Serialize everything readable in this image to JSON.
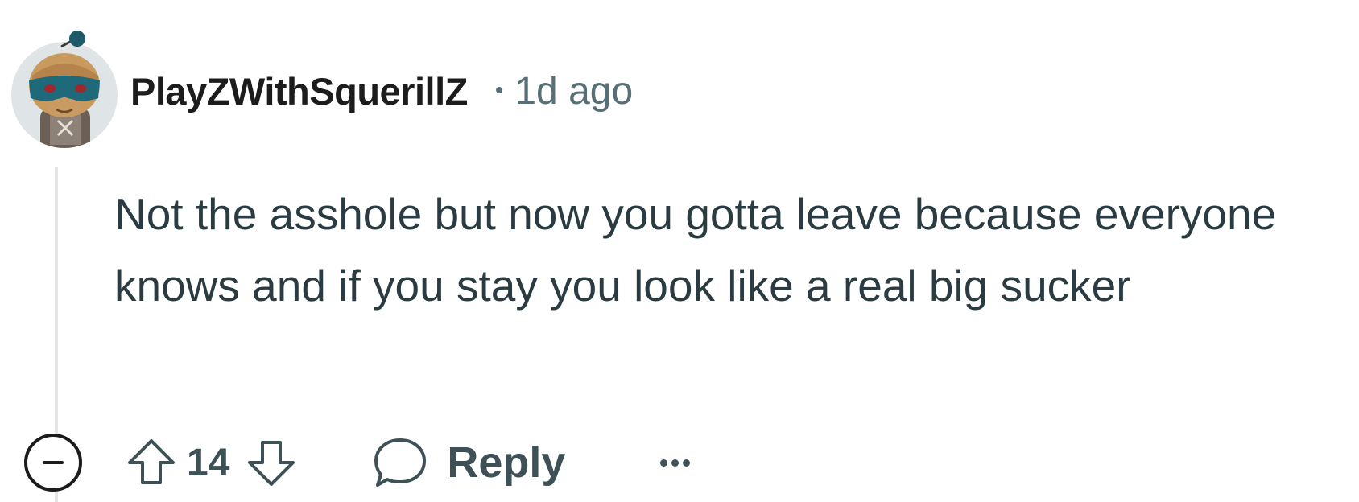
{
  "comment": {
    "username": "PlayZWithSquerillZ",
    "separator": "•",
    "timestamp": "1d ago",
    "body": "Not the asshole but now you gotta leave because everyone knows and if you stay you look like a real big sucker",
    "score": "14",
    "reply_label": "Reply"
  },
  "icons": {
    "avatar": "snoo-avatar-icon",
    "collapse": "minus-circle-icon",
    "upvote": "arrow-up-icon",
    "downvote": "arrow-down-icon",
    "reply": "speech-bubble-icon",
    "more": "ellipsis-icon"
  },
  "colors": {
    "text_primary": "#1c1c1c",
    "text_meta": "#576f76",
    "action_text": "#3d5157",
    "thread_line": "#e5e5e5"
  }
}
